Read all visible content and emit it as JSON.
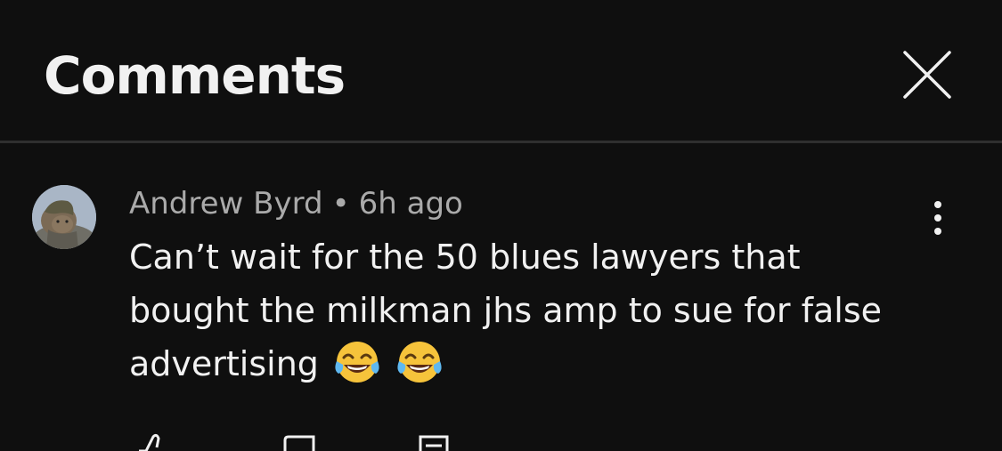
{
  "header": {
    "title": "Comments",
    "close_icon": "close-icon"
  },
  "comment": {
    "author": "Andrew Byrd",
    "separator": "•",
    "time": "6h ago",
    "text": "Can’t wait for the 50 blues lawyers that bought the milkman jhs amp to sue for false advertising",
    "emoji": [
      "face-with-tears-of-joy",
      "face-with-tears-of-joy"
    ],
    "menu_icon": "more-vertical-icon",
    "actions": [
      "like-icon",
      "dislike-icon",
      "reply-icon"
    ]
  },
  "colors": {
    "background": "#0f0f0f",
    "text_primary": "#f1f1f1",
    "text_secondary": "#aaaaaa",
    "divider": "#2f2f2f"
  }
}
